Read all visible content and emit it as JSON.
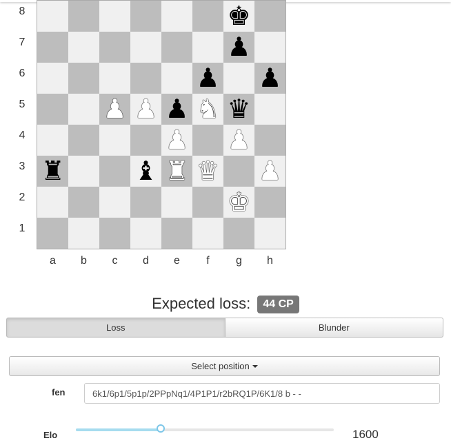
{
  "board": {
    "ranks": [
      "8",
      "7",
      "6",
      "5",
      "4",
      "3",
      "2",
      "1"
    ],
    "files": [
      "a",
      "b",
      "c",
      "d",
      "e",
      "f",
      "g",
      "h"
    ],
    "pieces": [
      {
        "square": "g8",
        "glyph": "♚",
        "color": "b",
        "name": "black-king"
      },
      {
        "square": "g7",
        "glyph": "♟",
        "color": "b",
        "name": "black-pawn"
      },
      {
        "square": "f6",
        "glyph": "♟",
        "color": "b",
        "name": "black-pawn"
      },
      {
        "square": "h6",
        "glyph": "♟",
        "color": "b",
        "name": "black-pawn"
      },
      {
        "square": "c5",
        "glyph": "♟",
        "color": "w",
        "name": "white-pawn"
      },
      {
        "square": "d5",
        "glyph": "♟",
        "color": "w",
        "name": "white-pawn"
      },
      {
        "square": "e5",
        "glyph": "♟",
        "color": "b",
        "name": "black-pawn"
      },
      {
        "square": "f5",
        "glyph": "♞",
        "color": "w",
        "name": "white-knight"
      },
      {
        "square": "g5",
        "glyph": "♛",
        "color": "b",
        "name": "black-queen"
      },
      {
        "square": "e4",
        "glyph": "♟",
        "color": "w",
        "name": "white-pawn"
      },
      {
        "square": "g4",
        "glyph": "♟",
        "color": "w",
        "name": "white-pawn"
      },
      {
        "square": "a3",
        "glyph": "♜",
        "color": "b",
        "name": "black-rook"
      },
      {
        "square": "d3",
        "glyph": "♝",
        "color": "b",
        "name": "black-bishop"
      },
      {
        "square": "e3",
        "glyph": "♜",
        "color": "w",
        "name": "white-rook"
      },
      {
        "square": "f3",
        "glyph": "♛",
        "color": "w",
        "name": "white-queen"
      },
      {
        "square": "h3",
        "glyph": "♟",
        "color": "w",
        "name": "white-pawn"
      },
      {
        "square": "g2",
        "glyph": "♚",
        "color": "w",
        "name": "white-king"
      }
    ]
  },
  "expected_loss": {
    "label": "Expected loss:",
    "badge": "44 CP"
  },
  "tabs": [
    {
      "label": "Loss",
      "active": true
    },
    {
      "label": "Blunder",
      "active": false
    }
  ],
  "select_position": {
    "label": "Select position"
  },
  "fen": {
    "label": "fen",
    "value": "6k1/6p1/5p1p/2PPpNq1/4P1P1/r2bRQ1P/6K1/8 b - -"
  },
  "elo": {
    "label": "Elo",
    "value": "1600",
    "slider_fraction": 0.33
  },
  "colors": {
    "light_square": "#f0f0f0",
    "dark_square": "#bdbdbd",
    "badge_bg": "#777777",
    "slider_fill": "#a6dcef"
  }
}
